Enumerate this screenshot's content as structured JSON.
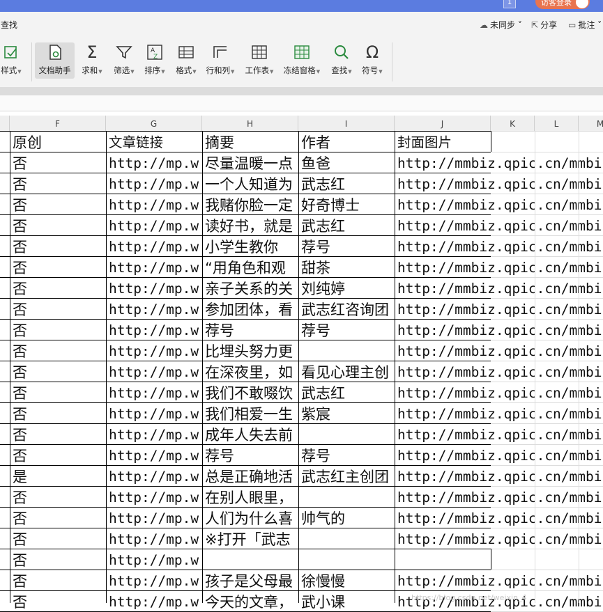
{
  "window": {
    "page_indicator": "1",
    "login_label": "访客登录"
  },
  "tabrow": {
    "find_label": "查找",
    "sync_label": "未同步",
    "share_label": "分享",
    "comment_label": "批注"
  },
  "ribbon": {
    "buttons": [
      {
        "label": "样式",
        "icon": "style-icon"
      },
      {
        "label": "文档助手",
        "icon": "doc-assistant-icon"
      },
      {
        "label": "求和",
        "icon": "sum-icon"
      },
      {
        "label": "筛选",
        "icon": "filter-icon"
      },
      {
        "label": "排序",
        "icon": "sort-icon"
      },
      {
        "label": "格式",
        "icon": "format-icon"
      },
      {
        "label": "行和列",
        "icon": "row-col-icon"
      },
      {
        "label": "工作表",
        "icon": "worksheet-icon"
      },
      {
        "label": "冻结窗格",
        "icon": "freeze-icon"
      },
      {
        "label": "查找",
        "icon": "search-icon"
      },
      {
        "label": "符号",
        "icon": "omega-icon"
      }
    ]
  },
  "columns": [
    "F",
    "G",
    "H",
    "I",
    "J",
    "K",
    "L",
    "M"
  ],
  "sheet": {
    "headers": {
      "f": "原创",
      "g": "文章链接",
      "h": "摘要",
      "i": "作者",
      "j": "封面图片"
    },
    "rows": [
      {
        "f": "否",
        "g": "http://mp.w",
        "h": "尽量温暖一点",
        "i": "鱼爸",
        "j": "http://mmbiz.qpic.cn/mmbi"
      },
      {
        "f": "否",
        "g": "http://mp.w",
        "h": "一个人知道为",
        "i": "武志红",
        "j": "http://mmbiz.qpic.cn/mmbi"
      },
      {
        "f": "否",
        "g": "http://mp.w",
        "h": "我赌你脸一定",
        "i": "好奇博士",
        "j": "http://mmbiz.qpic.cn/mmbi"
      },
      {
        "f": "否",
        "g": "http://mp.w",
        "h": "读好书，就是",
        "i": "武志红",
        "j": "http://mmbiz.qpic.cn/mmbi"
      },
      {
        "f": "否",
        "g": "http://mp.w",
        "h": "小学生教你",
        "i": "荐号",
        "j": "http://mmbiz.qpic.cn/mmbi"
      },
      {
        "f": "否",
        "g": "http://mp.w",
        "h": "“用角色和观",
        "i": "甜茶",
        "j": "http://mmbiz.qpic.cn/mmbi"
      },
      {
        "f": "否",
        "g": "http://mp.w",
        "h": "亲子关系的关",
        "i": "刘纯婷",
        "j": "http://mmbiz.qpic.cn/mmbi"
      },
      {
        "f": "否",
        "g": "http://mp.w",
        "h": "参加团体，看",
        "i": "武志红咨询团",
        "j": "http://mmbiz.qpic.cn/mmbi"
      },
      {
        "f": "否",
        "g": "http://mp.w",
        "h": "荐号",
        "i": "荐号",
        "j": "http://mmbiz.qpic.cn/mmbi"
      },
      {
        "f": "否",
        "g": "http://mp.w",
        "h": "比埋头努力更",
        "i": "",
        "j": "http://mmbiz.qpic.cn/mmbi"
      },
      {
        "f": "否",
        "g": "http://mp.w",
        "h": "在深夜里，如",
        "i": "看见心理主创",
        "j": "http://mmbiz.qpic.cn/mmbi"
      },
      {
        "f": "否",
        "g": "http://mp.w",
        "h": "我们不敢啜饮",
        "i": "武志红",
        "j": "http://mmbiz.qpic.cn/mmbi"
      },
      {
        "f": "否",
        "g": "http://mp.w",
        "h": "我们相爱一生",
        "i": "紫宸",
        "j": "http://mmbiz.qpic.cn/mmbi"
      },
      {
        "f": "否",
        "g": "http://mp.w",
        "h": "成年人失去前",
        "i": "",
        "j": "http://mmbiz.qpic.cn/mmbi"
      },
      {
        "f": "否",
        "g": "http://mp.w",
        "h": "荐号",
        "i": "荐号",
        "j": "http://mmbiz.qpic.cn/mmbi"
      },
      {
        "f": "是",
        "g": "http://mp.w",
        "h": "总是正确地活",
        "i": "武志红主创团",
        "j": "http://mmbiz.qpic.cn/mmbi"
      },
      {
        "f": "否",
        "g": "http://mp.w",
        "h": "在别人眼里，",
        "i": "",
        "j": "http://mmbiz.qpic.cn/mmbi"
      },
      {
        "f": "否",
        "g": "http://mp.w",
        "h": "人们为什么喜",
        "i": "帅气的",
        "j": "http://mmbiz.qpic.cn/mmbi"
      },
      {
        "f": "否",
        "g": "http://mp.w",
        "h": "※打开「武志",
        "i": "",
        "j": "http://mmbiz.qpic.cn/mmbi"
      },
      {
        "f": "否",
        "g": "http://mp.w",
        "h": "",
        "i": "",
        "j": ""
      },
      {
        "f": "否",
        "g": "http://mp.w",
        "h": "孩子是父母最",
        "i": "徐慢慢",
        "j": "http://mmbiz.qpic.cn/mmbi"
      },
      {
        "f": "否",
        "g": "http://mp.w",
        "h": "今天的文章，",
        "i": "武小课",
        "j": "http://mmbiz.qpic.cn/mmbi"
      }
    ]
  },
  "watermark": "https://blog.csdn.net/weixin_4"
}
